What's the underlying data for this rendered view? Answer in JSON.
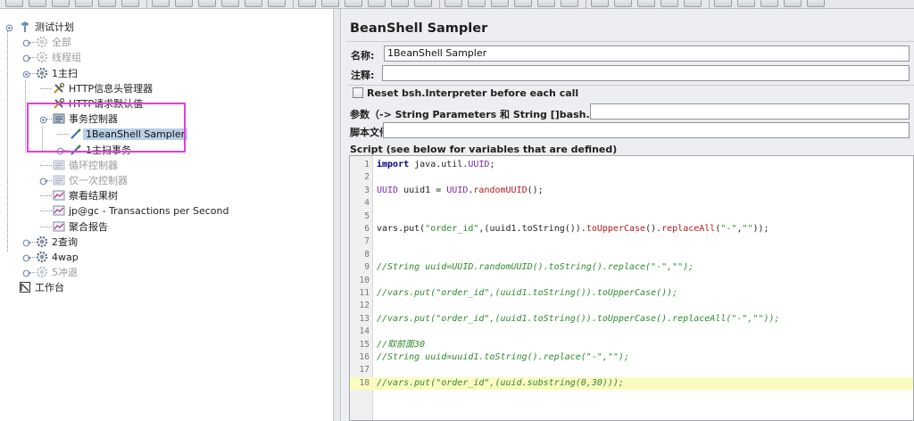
{
  "toolbar": {
    "button_count": 34
  },
  "tree": {
    "nodes": [
      {
        "label": "测试计划",
        "icon": "test-plan-icon",
        "state": "normal"
      },
      {
        "label": "全部",
        "icon": "gear-icon",
        "state": "disabled"
      },
      {
        "label": "线程组",
        "icon": "gear-icon",
        "state": "disabled"
      },
      {
        "label": "1主扫",
        "icon": "gear-icon",
        "state": "normal"
      },
      {
        "label": "HTTP信息头管理器",
        "icon": "wrench-icon",
        "state": "normal"
      },
      {
        "label": "HTTP请求默认值",
        "icon": "wrench-icon",
        "state": "normal"
      },
      {
        "label": "事务控制器",
        "icon": "controller-icon",
        "state": "normal"
      },
      {
        "label": "1BeanShell Sampler",
        "icon": "pipette-icon",
        "state": "selected"
      },
      {
        "label": "1主扫事务",
        "icon": "pipette-icon",
        "state": "normal"
      },
      {
        "label": "循环控制器",
        "icon": "controller-icon",
        "state": "disabled"
      },
      {
        "label": "仅一次控制器",
        "icon": "controller-icon",
        "state": "disabled"
      },
      {
        "label": "察看结果树",
        "icon": "chart-icon",
        "state": "normal"
      },
      {
        "label": "jp@gc - Transactions per Second",
        "icon": "chart-icon",
        "state": "normal"
      },
      {
        "label": "聚合报告",
        "icon": "chart-icon",
        "state": "normal"
      },
      {
        "label": "2查询",
        "icon": "gear-icon",
        "state": "normal"
      },
      {
        "label": "4wap",
        "icon": "gear-icon",
        "state": "normal"
      },
      {
        "label": "5冲退",
        "icon": "gear-icon",
        "state": "disabled"
      },
      {
        "label": "工作台",
        "icon": "workbench-icon",
        "state": "normal"
      }
    ]
  },
  "panel": {
    "title": "BeanShell Sampler",
    "name_label": "名称:",
    "name_value": "1BeanShell Sampler",
    "comment_label": "注释:",
    "comment_value": "",
    "reset_label": "Reset bsh.Interpreter before each call",
    "reset_checked": false,
    "params_label": "参数（-> String Parameters 和 String []bash.args）",
    "params_value": "",
    "script_file_label": "脚本文件",
    "script_file_value": "",
    "script_label": "Script (see below for variables that are defined)"
  },
  "script": {
    "highlight_line": 18,
    "lines": [
      "import java.util.UUID;",
      "",
      "UUID uuid1 = UUID.randomUUID();",
      "",
      "",
      "vars.put(\"order_id\",(uuid1.toString()).toUpperCase().replaceAll(\"-\",\"\"));",
      "",
      "",
      "//String uuid=UUID.randomUUID().toString().replace(\"-\",\"\");",
      "",
      "//vars.put(\"order_id\",(uuid1.toString()).toUpperCase());",
      "",
      "//vars.put(\"order_id\",(uuid1.toString()).toUpperCase().replaceAll(\"-\",\"\"));",
      "",
      "//取前面30",
      "//String uuid=uuid1.toString().replace(\"-\",\"\");",
      "",
      "//vars.put(\"order_id\",(uuid.substring(0,30)));"
    ]
  },
  "colors": {
    "selection": "#b8cfe5",
    "highlight_box": "#e23fd8",
    "current_line": "#fbfbc0",
    "keyword": "#00008b",
    "string": "#2a8f2a",
    "comment": "#2e8b2e"
  }
}
